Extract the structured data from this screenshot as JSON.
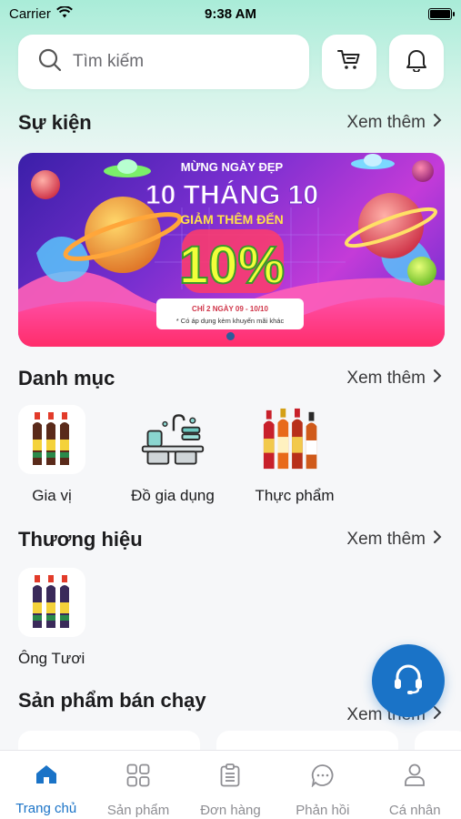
{
  "status_bar": {
    "carrier": "Carrier",
    "time": "9:38 AM"
  },
  "search": {
    "placeholder": "Tìm kiếm"
  },
  "sections": {
    "events": {
      "title": "Sự kiện",
      "see_more": "Xem thêm"
    },
    "categories": {
      "title": "Danh mục",
      "see_more": "Xem thêm"
    },
    "brands": {
      "title": "Thương hiệu",
      "see_more": "Xem thêm"
    },
    "best_sellers": {
      "title": "Sản phẩm bán chạy",
      "see_more": "Xem thêm"
    }
  },
  "banner": {
    "line1": "MỪNG NGÀY ĐẸP",
    "line2": "10 THÁNG 10",
    "line3": "GIẢM THÊM ĐẾN",
    "big": "10%",
    "note1": "CHỈ 2 NGÀY 09 - 10/10",
    "note2": "* Có áp dụng kèm khuyến mãi khác"
  },
  "categories": [
    {
      "label": "Gia vị",
      "icon": "sauce-bottles-icon"
    },
    {
      "label": "Đồ gia dụng",
      "icon": "kitchen-sink-icon"
    },
    {
      "label": "Thực phẩm",
      "icon": "food-bottles-icon"
    }
  ],
  "brands": [
    {
      "label": "Ông Tươi",
      "icon": "sauce-bottles-icon"
    }
  ],
  "tabs": [
    {
      "label": "Trang chủ",
      "icon": "home-icon",
      "active": true
    },
    {
      "label": "Sản phẩm",
      "icon": "grid-icon",
      "active": false
    },
    {
      "label": "Đơn hàng",
      "icon": "clipboard-icon",
      "active": false
    },
    {
      "label": "Phản hồi",
      "icon": "chat-bubble-icon",
      "active": false
    },
    {
      "label": "Cá nhân",
      "icon": "user-icon",
      "active": false
    }
  ],
  "colors": {
    "accent": "#1a73c7",
    "tab_inactive": "#8e8e93",
    "header_mint": "#a9ecd8"
  }
}
